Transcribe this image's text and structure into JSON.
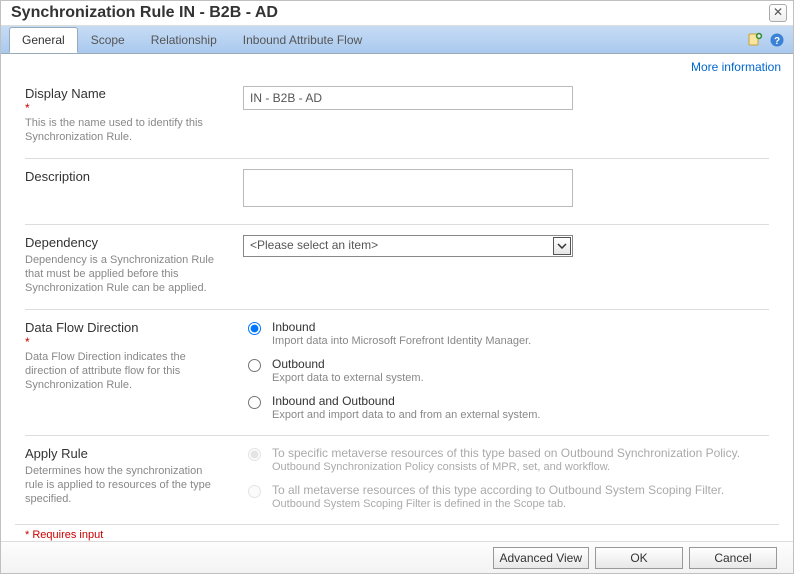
{
  "title": "Synchronization Rule IN - B2B - AD",
  "tabs": [
    "General",
    "Scope",
    "Relationship",
    "Inbound Attribute Flow"
  ],
  "active_tab": 0,
  "more_info": "More information",
  "fields": {
    "display_name": {
      "label": "Display Name",
      "desc": "This is the name used to identify this Synchronization Rule.",
      "value": "IN - B2B - AD"
    },
    "description": {
      "label": "Description",
      "value": ""
    },
    "dependency": {
      "label": "Dependency",
      "desc": "Dependency is a Synchronization Rule that must be applied before this Synchronization Rule can be applied.",
      "placeholder": "<Please select an item>"
    },
    "flow": {
      "label": "Data Flow Direction",
      "desc": "Data Flow Direction indicates the direction of attribute flow for this Synchronization Rule.",
      "options": [
        {
          "title": "Inbound",
          "desc": "Import data into Microsoft Forefront Identity Manager.",
          "checked": true
        },
        {
          "title": "Outbound",
          "desc": "Export data to external system.",
          "checked": false
        },
        {
          "title": "Inbound and Outbound",
          "desc": "Export and import data to and from an external system.",
          "checked": false
        }
      ]
    },
    "apply": {
      "label": "Apply Rule",
      "desc": "Determines how the synchronization rule is applied to resources of the type specified.",
      "options": [
        {
          "title": "To specific metaverse resources of this type based on Outbound Synchronization Policy.",
          "desc": "Outbound Synchronization Policy consists of MPR, set, and workflow.",
          "checked": true
        },
        {
          "title": "To all metaverse resources of this type according to Outbound System Scoping Filter.",
          "desc": "Outbound System Scoping Filter is defined in the Scope tab.",
          "checked": false
        }
      ]
    }
  },
  "requires_input": "* Requires input",
  "buttons": {
    "advanced": "Advanced View",
    "ok": "OK",
    "cancel": "Cancel"
  }
}
